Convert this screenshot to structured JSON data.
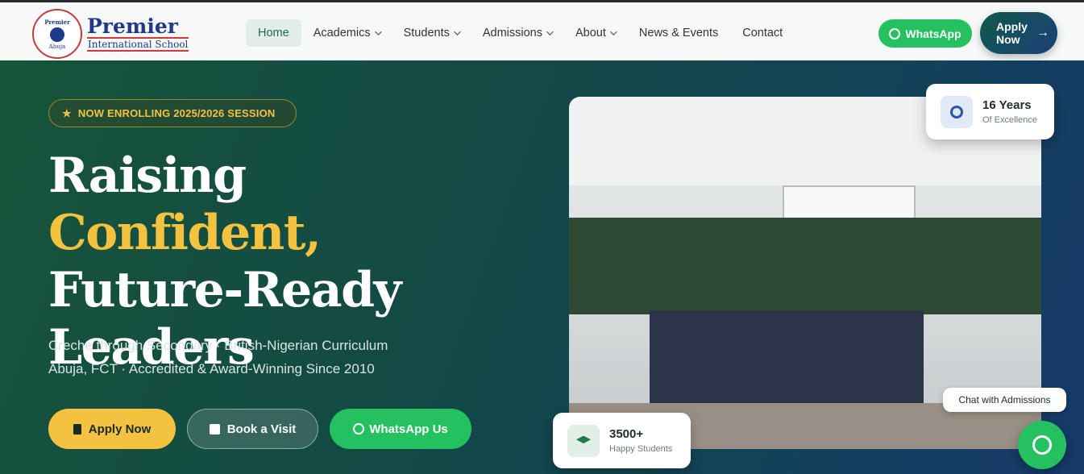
{
  "header": {
    "logo": {
      "name": "Premier",
      "subtitle": "International School",
      "seal_top": "Premier",
      "seal_bottom": "Abuja"
    },
    "nav": [
      {
        "label": "Home",
        "active": true,
        "dropdown": false
      },
      {
        "label": "Academics",
        "active": false,
        "dropdown": true
      },
      {
        "label": "Students",
        "active": false,
        "dropdown": true
      },
      {
        "label": "Admissions",
        "active": false,
        "dropdown": true
      },
      {
        "label": "About",
        "active": false,
        "dropdown": true
      },
      {
        "label": "News & Events",
        "active": false,
        "dropdown": false
      },
      {
        "label": "Contact",
        "active": false,
        "dropdown": false
      }
    ],
    "whatsapp_label": "WhatsApp",
    "apply_label": "Apply Now"
  },
  "hero": {
    "badge": "NOW ENROLLING 2025/2026 SESSION",
    "headline": {
      "part1": "Raising ",
      "accent": "Confident,",
      "line2": "Future-Ready",
      "line3": "Leaders"
    },
    "subtext_line1": "Creche through Secondary · British-Nigerian Curriculum",
    "subtext_line2": "Abuja, FCT · Accredited & Award-Winning Since 2010",
    "buttons": {
      "apply": "Apply Now",
      "visit": "Book a Visit",
      "whatsapp": "WhatsApp Us"
    },
    "years_card": {
      "value": "16 Years",
      "label": "Of Excellence"
    },
    "students_card": {
      "value": "3500+",
      "label": "Happy Students"
    },
    "chat_tooltip": "Chat with Admissions"
  },
  "colors": {
    "accent_gold": "#f3c240",
    "whatsapp_green": "#25c160",
    "brand_blue": "#1f3a8a"
  },
  "icons": [
    "star-icon",
    "document-icon",
    "calendar-icon",
    "whatsapp-icon",
    "award-icon",
    "graduation-cap-icon",
    "arrow-right-icon",
    "chevron-down-icon"
  ]
}
